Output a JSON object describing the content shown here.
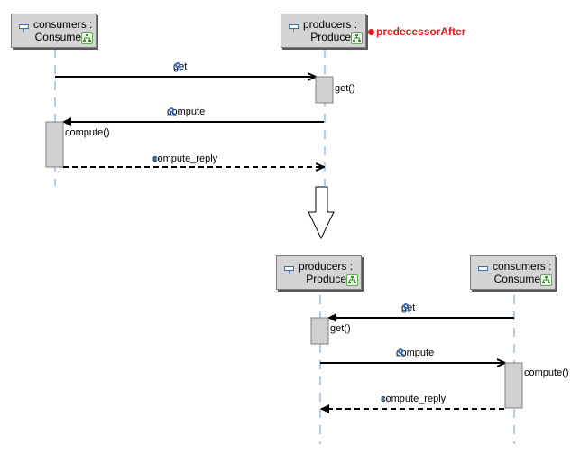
{
  "colors": {
    "lifeline_box": "#d4d4d4",
    "lifeline_dash": "#6a9ad0",
    "execution_box": "#d0d0d0",
    "annotation_red": "#e8141e",
    "message_icon": "#3a6eb5"
  },
  "before": {
    "lifelines": [
      {
        "name": "consumers :",
        "type": "Consume",
        "icon": "lifeline-object-icon",
        "badge_icon": "structure-hierarchy-icon"
      },
      {
        "name": "producers :",
        "type": "Produce",
        "icon": "lifeline-object-icon",
        "badge_icon": "structure-hierarchy-icon"
      }
    ],
    "annotation": {
      "text": "predecessorAfter",
      "marker": "red-dot"
    },
    "messages": [
      {
        "label": "get",
        "from": "consumers",
        "to": "producers",
        "kind": "sync-call",
        "icon": "operation-gear-icon",
        "execution_label": "get()"
      },
      {
        "label": "compute",
        "from": "producers",
        "to": "consumers",
        "kind": "sync-call",
        "icon": "operation-gear-icon",
        "execution_label": "compute()"
      },
      {
        "label": "compute_reply",
        "from": "consumers",
        "to": "producers",
        "kind": "reply",
        "icon": "reply-arrow-icon"
      }
    ]
  },
  "transition": {
    "icon": "down-arrow-icon"
  },
  "after": {
    "lifelines": [
      {
        "name": "producers :",
        "type": "Produce",
        "icon": "lifeline-object-icon",
        "badge_icon": "structure-hierarchy-icon"
      },
      {
        "name": "consumers :",
        "type": "Consume",
        "icon": "lifeline-object-icon",
        "badge_icon": "structure-hierarchy-icon"
      }
    ],
    "messages": [
      {
        "label": "get",
        "from": "consumers",
        "to": "producers",
        "kind": "sync-call",
        "icon": "operation-gear-icon",
        "execution_label": "get()"
      },
      {
        "label": "compute",
        "from": "producers",
        "to": "consumers",
        "kind": "sync-call",
        "icon": "operation-gear-icon",
        "execution_label": "compute()"
      },
      {
        "label": "compute_reply",
        "from": "consumers",
        "to": "producers",
        "kind": "reply",
        "icon": "reply-arrow-icon"
      }
    ]
  }
}
